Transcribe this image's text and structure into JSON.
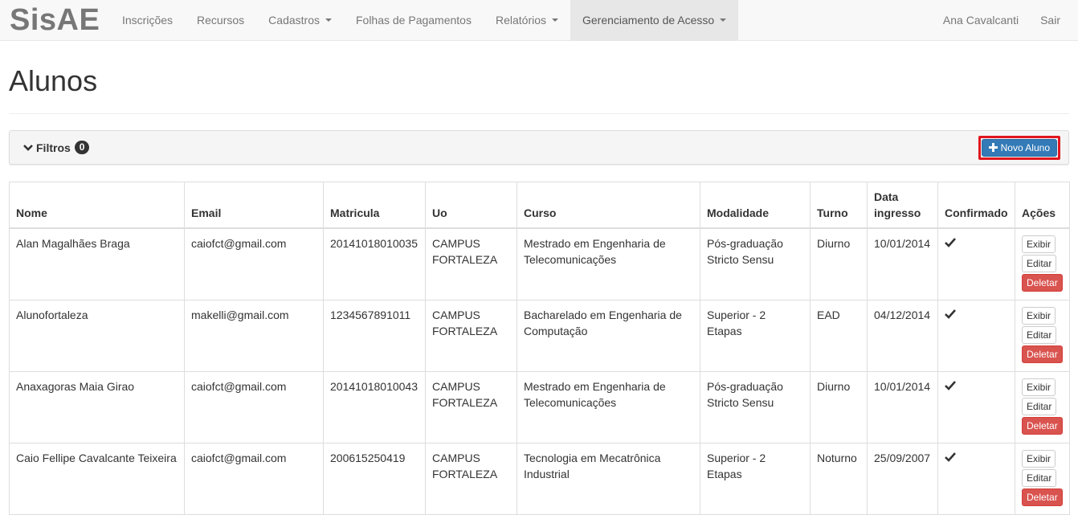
{
  "navbar": {
    "brand": "SisAE",
    "items": [
      {
        "label": "Inscrições"
      },
      {
        "label": "Recursos"
      },
      {
        "label": "Cadastros"
      },
      {
        "label": "Folhas de Pagamentos"
      },
      {
        "label": "Relatórios"
      },
      {
        "label": "Gerenciamento de Acesso"
      }
    ],
    "user": "Ana Cavalcanti",
    "logout": "Sair"
  },
  "page": {
    "title": "Alunos"
  },
  "filters": {
    "label": "Filtros",
    "count": "0",
    "new_button": "Novo Aluno"
  },
  "table": {
    "headers": {
      "nome": "Nome",
      "email": "Email",
      "matricula": "Matricula",
      "uo": "Uo",
      "curso": "Curso",
      "modalidade": "Modalidade",
      "turno": "Turno",
      "data_ingresso": "Data ingresso",
      "confirmado": "Confirmado",
      "acoes": "Ações"
    },
    "actions": {
      "show": "Exibir",
      "edit": "Editar",
      "delete": "Deletar"
    },
    "rows": [
      {
        "nome": "Alan Magalhães Braga",
        "email": "caiofct@gmail.com",
        "matricula": "20141018010035",
        "uo": "CAMPUS FORTALEZA",
        "curso": "Mestrado em Engenharia de Telecomunicações",
        "modalidade": "Pós-graduação Stricto Sensu",
        "turno": "Diurno",
        "data_ingresso": "10/01/2014"
      },
      {
        "nome": "Alunofortaleza",
        "email": "makelli@gmail.com",
        "matricula": "1234567891011",
        "uo": "CAMPUS FORTALEZA",
        "curso": "Bacharelado em Engenharia de Computação",
        "modalidade": "Superior - 2 Etapas",
        "turno": "EAD",
        "data_ingresso": "04/12/2014"
      },
      {
        "nome": "Anaxagoras Maia Girao",
        "email": "caiofct@gmail.com",
        "matricula": "20141018010043",
        "uo": "CAMPUS FORTALEZA",
        "curso": "Mestrado em Engenharia de Telecomunicações",
        "modalidade": "Pós-graduação Stricto Sensu",
        "turno": "Diurno",
        "data_ingresso": "10/01/2014"
      },
      {
        "nome": "Caio Fellipe Cavalcante Teixeira",
        "email": "caiofct@gmail.com",
        "matricula": "200615250419",
        "uo": "CAMPUS FORTALEZA",
        "curso": "Tecnologia em Mecatrônica Industrial",
        "modalidade": "Superior - 2 Etapas",
        "turno": "Noturno",
        "data_ingresso": "25/09/2007"
      }
    ]
  },
  "colors": {
    "primary": "#337ab7",
    "danger": "#d9534f",
    "highlight": "#e0161f"
  }
}
